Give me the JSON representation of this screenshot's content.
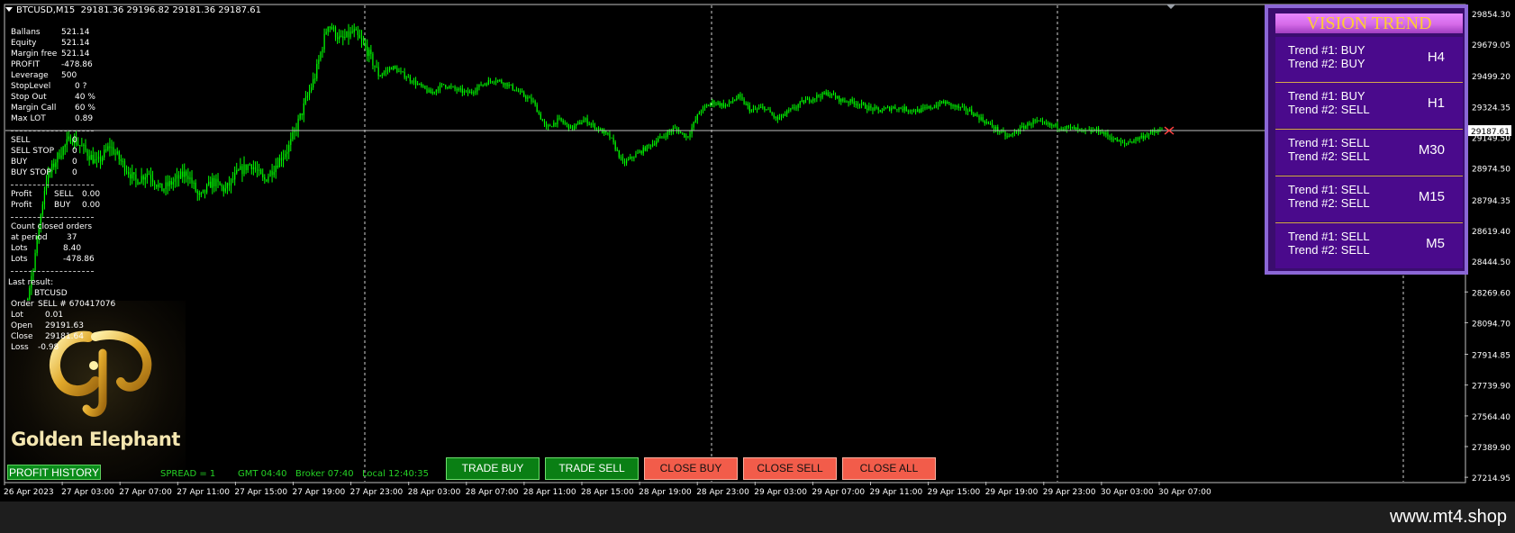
{
  "header": {
    "symbol": "BTCUSD,M15",
    "ohlc": "29181.36 29196.82 29181.36 29187.61"
  },
  "account_info": [
    {
      "label": "Ballans",
      "value": "521.14"
    },
    {
      "label": "Equity",
      "value": "521.14"
    },
    {
      "label": "Margin free",
      "value": "521.14"
    },
    {
      "label": "PROFIT",
      "value": "-478.86"
    },
    {
      "label": "Leverage",
      "value": "500"
    },
    {
      "label": "StopLevel",
      "value": "0 ?"
    },
    {
      "label": "Stop Out",
      "value": "40 %"
    },
    {
      "label": "Margin Call",
      "value": "60 %"
    },
    {
      "label": "Max LOT",
      "value": "0.89"
    }
  ],
  "orders": [
    {
      "label": "SELL",
      "value": "0"
    },
    {
      "label": "SELL STOP",
      "value": "0"
    },
    {
      "label": "BUY",
      "value": "0"
    },
    {
      "label": "BUY STOP",
      "value": "0"
    }
  ],
  "profit_rows": [
    {
      "label": "Profit",
      "side": "SELL",
      "value": "0.00"
    },
    {
      "label": "Profit",
      "side": "BUY",
      "value": "0.00"
    }
  ],
  "closed_orders": {
    "title": "Count closed orders",
    "rows": [
      {
        "label": "at period",
        "value": "37"
      },
      {
        "label": "Lots",
        "value": "8.40"
      },
      {
        "label": "Lots",
        "value": "-478.86"
      }
    ]
  },
  "last_result": {
    "title": "Last result:",
    "symbol": "BTCUSD",
    "rows": [
      {
        "label": "Order",
        "value": "SELL   # 670417076"
      },
      {
        "label": "Lot",
        "value": "0.01"
      },
      {
        "label": "Open",
        "value": "29191.63"
      },
      {
        "label": "Close",
        "value": "29181.64"
      },
      {
        "label": "Loss",
        "value": "-0.98"
      }
    ]
  },
  "logo": {
    "text": "Golden Elephant"
  },
  "buttons": {
    "profit_history": "PROFIT HISTORY",
    "trade_buy": "TRADE BUY",
    "trade_sell": "TRADE SELL",
    "close_buy": "CLOSE BUY",
    "close_sell": "CLOSE SELL",
    "close_all": "CLOSE ALL"
  },
  "status": {
    "spread": "SPREAD = 1",
    "gmt": "GMT 04:40",
    "broker": "Broker 07:40",
    "local": "Local 12:40:35"
  },
  "vision_trend": {
    "title": "VISION TREND",
    "rows": [
      {
        "trend1": "Trend #1: BUY",
        "trend2": "Trend #2: BUY",
        "timeframe": "H4"
      },
      {
        "trend1": "Trend #1: BUY",
        "trend2": "Trend #2: SELL",
        "timeframe": "H1"
      },
      {
        "trend1": "Trend #1: SELL",
        "trend2": "Trend #2: SELL",
        "timeframe": "M30"
      },
      {
        "trend1": "Trend #1: SELL",
        "trend2": "Trend #2: SELL",
        "timeframe": "M15"
      },
      {
        "trend1": "Trend #1: SELL",
        "trend2": "Trend #2: SELL",
        "timeframe": "M5"
      }
    ]
  },
  "footer": {
    "url": "www.mt4.shop"
  },
  "colors": {
    "background": "#000000",
    "candle": "#00ff00",
    "bid_line": "#c0c0c0",
    "price_tag_bg": "#ffffff",
    "panel_bg": "#3a0d6e",
    "panel_border": "#8b67d6",
    "panel_title": "#ffcc33",
    "buy_button": "#0a7f14",
    "close_button": "#f25c4a"
  },
  "chart_data": {
    "type": "candlestick",
    "symbol": "BTCUSD",
    "timeframe": "M15",
    "current_price": 29187.61,
    "price_labels": [
      "29854.30",
      "29679.05",
      "29499.20",
      "29324.35",
      "29149.50",
      "28974.50",
      "28794.35",
      "28619.40",
      "28444.50",
      "28269.60",
      "28094.70",
      "27914.85",
      "27739.90",
      "27564.40",
      "27389.90",
      "27214.95"
    ],
    "ticks": [
      29854.3,
      29679.05,
      29499.2,
      29324.35,
      29149.5,
      28974.5,
      28794.35,
      28619.4,
      28444.5,
      28269.6,
      28094.7,
      27914.85,
      27739.9,
      27564.4,
      27389.9,
      27214.95
    ],
    "time_labels": [
      "26 Apr 2023",
      "27 Apr 03:00",
      "27 Apr 07:00",
      "27 Apr 11:00",
      "27 Apr 15:00",
      "27 Apr 19:00",
      "27 Apr 23:00",
      "28 Apr 03:00",
      "28 Apr 07:00",
      "28 Apr 11:00",
      "28 Apr 15:00",
      "28 Apr 19:00",
      "28 Apr 23:00",
      "29 Apr 03:00",
      "29 Apr 07:00",
      "29 Apr 11:00",
      "29 Apr 15:00",
      "29 Apr 19:00",
      "29 Apr 23:00",
      "30 Apr 03:00",
      "30 Apr 07:00"
    ],
    "ylim": [
      27190,
      29900
    ],
    "close_path": [
      [
        0,
        27600
      ],
      [
        2,
        28000
      ],
      [
        4,
        28400
      ],
      [
        6,
        28900
      ],
      [
        8,
        29050
      ],
      [
        10,
        29150
      ],
      [
        12,
        29080
      ],
      [
        14,
        29000
      ],
      [
        16,
        29100
      ],
      [
        18,
        29000
      ],
      [
        20,
        28900
      ],
      [
        22,
        28950
      ],
      [
        24,
        28850
      ],
      [
        26,
        28900
      ],
      [
        28,
        28950
      ],
      [
        30,
        28800
      ],
      [
        32,
        28900
      ],
      [
        34,
        28850
      ],
      [
        36,
        28950
      ],
      [
        38,
        29000
      ],
      [
        40,
        28900
      ],
      [
        42,
        29000
      ],
      [
        44,
        29100
      ],
      [
        46,
        29300
      ],
      [
        48,
        29500
      ],
      [
        50,
        29800
      ],
      [
        52,
        29700
      ],
      [
        54,
        29750
      ],
      [
        56,
        29650
      ],
      [
        58,
        29500
      ],
      [
        60,
        29550
      ],
      [
        62,
        29500
      ],
      [
        64,
        29450
      ],
      [
        66,
        29400
      ],
      [
        68,
        29450
      ],
      [
        70,
        29420
      ],
      [
        72,
        29400
      ],
      [
        74,
        29450
      ],
      [
        76,
        29480
      ],
      [
        78,
        29450
      ],
      [
        80,
        29400
      ],
      [
        82,
        29350
      ],
      [
        84,
        29200
      ],
      [
        86,
        29250
      ],
      [
        88,
        29200
      ],
      [
        90,
        29250
      ],
      [
        92,
        29200
      ],
      [
        94,
        29150
      ],
      [
        96,
        29000
      ],
      [
        98,
        29050
      ],
      [
        100,
        29100
      ],
      [
        102,
        29150
      ],
      [
        104,
        29200
      ],
      [
        106,
        29150
      ],
      [
        108,
        29300
      ],
      [
        110,
        29350
      ],
      [
        112,
        29330
      ],
      [
        114,
        29380
      ],
      [
        116,
        29300
      ],
      [
        118,
        29320
      ],
      [
        120,
        29250
      ],
      [
        122,
        29300
      ],
      [
        124,
        29350
      ],
      [
        126,
        29380
      ],
      [
        128,
        29400
      ],
      [
        130,
        29360
      ],
      [
        132,
        29350
      ],
      [
        134,
        29320
      ],
      [
        136,
        29300
      ],
      [
        138,
        29320
      ],
      [
        140,
        29310
      ],
      [
        142,
        29300
      ],
      [
        144,
        29320
      ],
      [
        146,
        29350
      ],
      [
        148,
        29320
      ],
      [
        150,
        29300
      ],
      [
        152,
        29250
      ],
      [
        154,
        29200
      ],
      [
        156,
        29150
      ],
      [
        158,
        29200
      ],
      [
        160,
        29240
      ],
      [
        162,
        29220
      ],
      [
        164,
        29210
      ],
      [
        166,
        29200
      ],
      [
        168,
        29180
      ],
      [
        170,
        29190
      ],
      [
        172,
        29150
      ],
      [
        174,
        29110
      ],
      [
        176,
        29140
      ],
      [
        178,
        29170
      ],
      [
        180,
        29187
      ]
    ]
  }
}
